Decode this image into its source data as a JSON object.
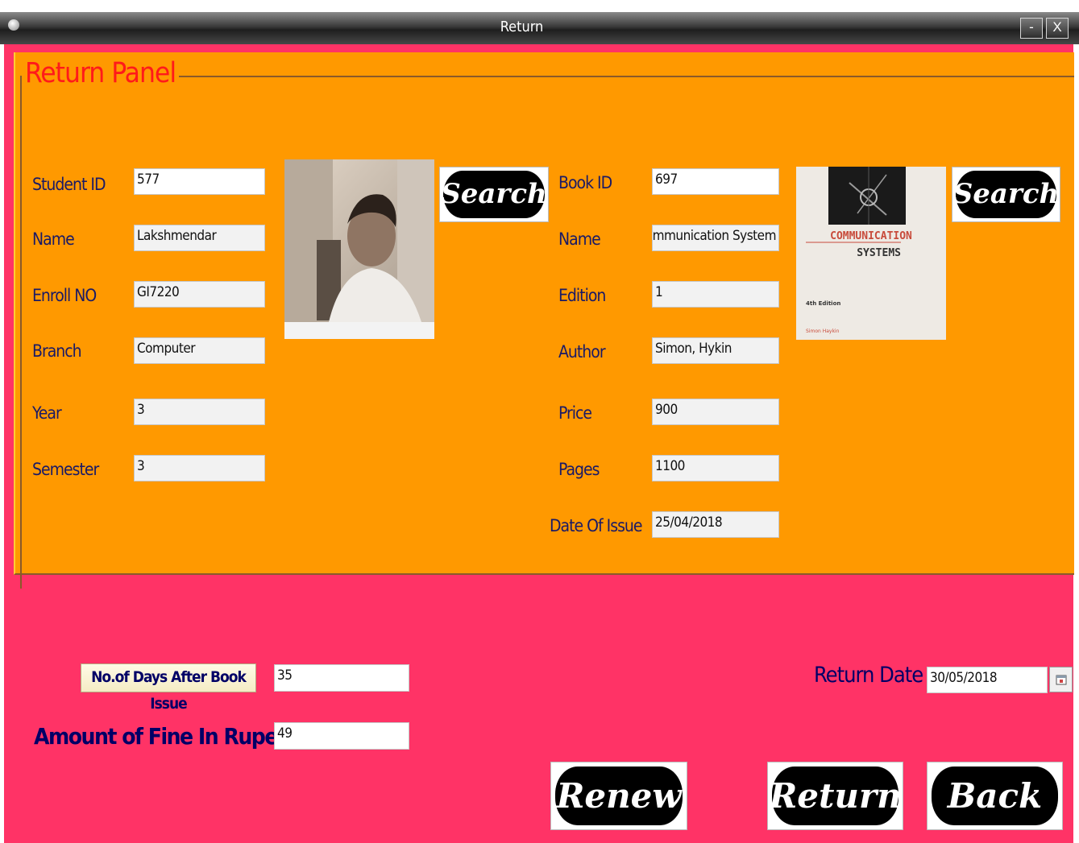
{
  "window": {
    "title": "Return",
    "minimize_label": "-",
    "close_label": "X"
  },
  "panel": {
    "title": "Return Panel"
  },
  "student": {
    "labels": [
      "Student ID",
      "Name",
      "Enroll NO",
      "Branch",
      "Year",
      "Semester"
    ],
    "values": [
      "577",
      "Lakshmendar",
      "GI7220",
      "Computer",
      "3",
      "3"
    ],
    "search_label": "Search"
  },
  "book": {
    "labels": [
      "Book ID",
      "Name",
      "Edition",
      "Author",
      "Price",
      "Pages",
      "Date Of Issue"
    ],
    "values": [
      "697",
      "Communication System",
      "1",
      "Simon, Hykin",
      "900",
      "1100",
      "25/04/2018"
    ],
    "search_label": "Search",
    "cover": {
      "line1": "COMMUNICATION",
      "line2": "SYSTEMS",
      "edition": "4th Edition",
      "author": "Simon Haykin"
    }
  },
  "footer": {
    "days_button_label": "No.of Days After Book Issue",
    "days_value": "35",
    "fine_label": "Amount of Fine In Rupees",
    "fine_value": "49",
    "return_date_label": "Return Date",
    "return_date_value": "30/05/2018",
    "renew_label": "Renew",
    "return_label": "Return",
    "back_label": "Back"
  },
  "icons": {
    "app": "java-cup-icon",
    "calendar": "calendar-icon"
  },
  "colors": {
    "background": "#ff3366",
    "panel": "#ff9900",
    "panel_title": "#ff1a1a",
    "label": "#1a1a66"
  }
}
